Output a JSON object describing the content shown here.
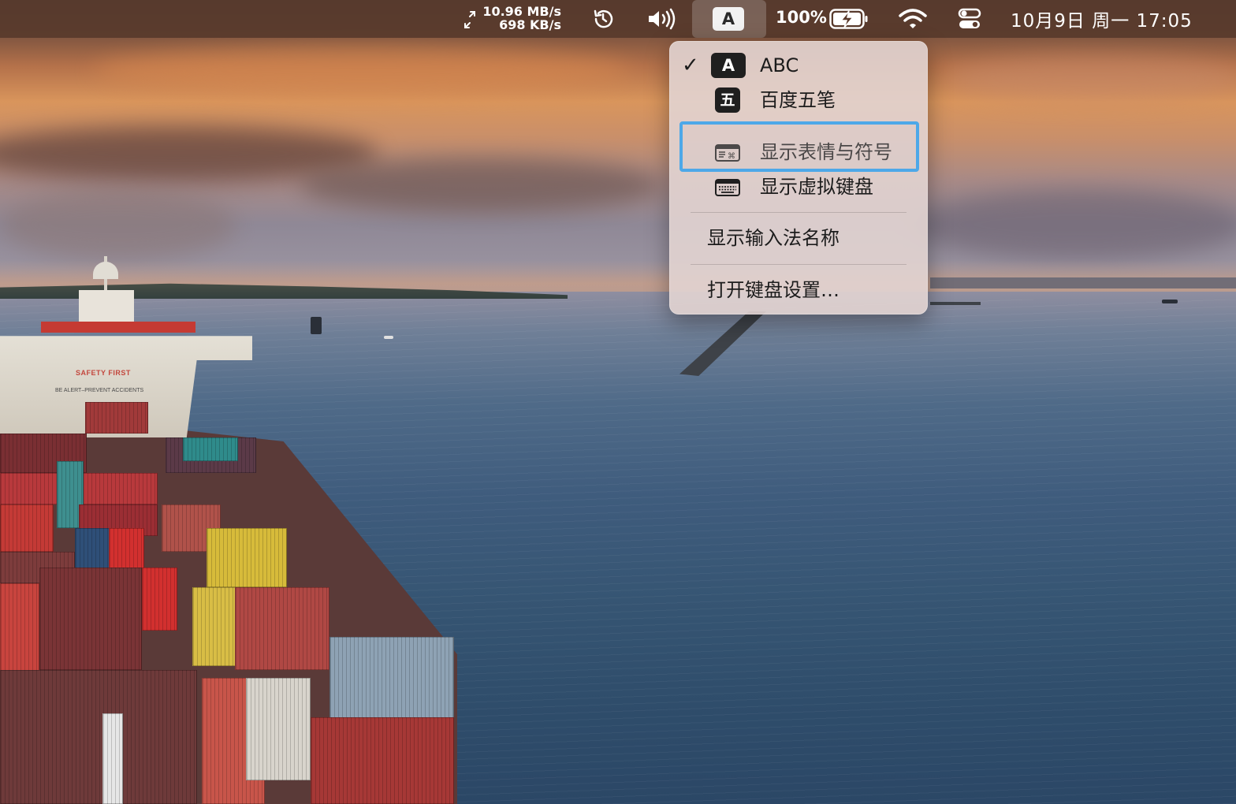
{
  "menubar": {
    "net_upload": "10.96 MB/s",
    "net_download": "698 KB/s",
    "input_source_letter": "A",
    "battery_percent": "100%",
    "clock": "10月9日 周一  17:05",
    "icons": [
      "network-speed-icon",
      "time-machine-icon",
      "volume-icon",
      "input-source-icon",
      "battery-charging-icon",
      "wifi-icon",
      "control-center-icon"
    ]
  },
  "input_menu": {
    "sources": [
      {
        "icon_text": "A",
        "label": "ABC",
        "checked": true
      },
      {
        "icon_text": "五",
        "label": "百度五笔",
        "checked": false
      }
    ],
    "check_mark": "✓",
    "actions": [
      {
        "label": "显示表情与符号",
        "icon": "emoji-symbols-icon",
        "highlighted": true
      },
      {
        "label": "显示虚拟键盘",
        "icon": "keyboard-viewer-icon",
        "highlighted": false
      }
    ],
    "show_input_name_label": "显示输入法名称",
    "open_keyboard_settings_label": "打开键盘设置…",
    "highlight_color": "#4da8e8"
  },
  "wallpaper": {
    "ship_sign": "SAFETY FIRST",
    "ship_subsign": "BE ALERT–PREVENT ACCIDENTS"
  }
}
